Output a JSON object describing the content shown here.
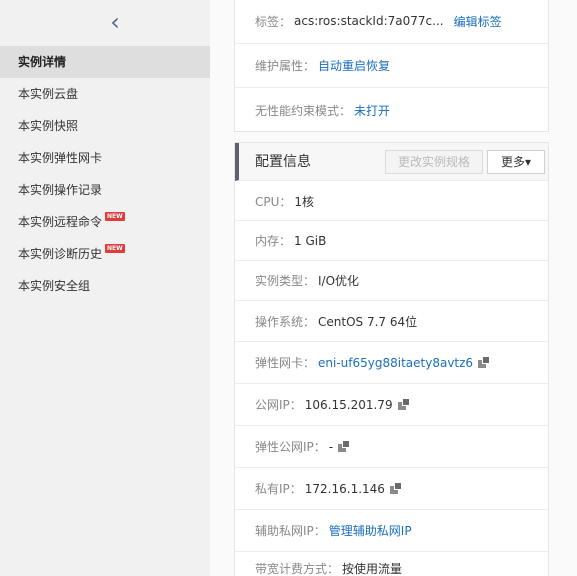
{
  "sidebar": {
    "back_glyph": "‹",
    "items": [
      {
        "label": "实例详情"
      },
      {
        "label": "本实例云盘"
      },
      {
        "label": "本实例快照"
      },
      {
        "label": "本实例弹性网卡"
      },
      {
        "label": "本实例操作记录"
      },
      {
        "label": "本实例远程命令",
        "badge": "NEW"
      },
      {
        "label": "本实例诊断历史",
        "badge": "NEW"
      },
      {
        "label": "本实例安全组"
      }
    ]
  },
  "info": {
    "tags_label": "标签：",
    "tags_value": "acs:ros:stackId:7a077c...",
    "tags_edit": "编辑标签",
    "maint_label": "维护属性：",
    "maint_value": "自动重启恢复",
    "perf_label": "无性能约束模式：",
    "perf_value": "未打开"
  },
  "config": {
    "title": "配置信息",
    "change_spec_button": "更改实例规格",
    "more_button": "更多▾",
    "rows": [
      {
        "label": "CPU：",
        "value": "1核"
      },
      {
        "label": "内存：",
        "value": "1 GiB"
      },
      {
        "label": "实例类型：",
        "value": "I/O优化"
      },
      {
        "label": "操作系统：",
        "value": "CentOS 7.7 64位"
      },
      {
        "label": "弹性网卡：",
        "value": "eni-uf65yg88itaety8avtz6"
      },
      {
        "label": "公网IP：",
        "value": "106.15.201.79"
      },
      {
        "label": "弹性公网IP：",
        "value": "-"
      },
      {
        "label": "私有IP：",
        "value": "172.16.1.146"
      },
      {
        "label": "辅助私网IP：",
        "value": "管理辅助私网IP"
      },
      {
        "label": "带宽计费方式：",
        "value": "按使用流量"
      }
    ]
  },
  "icons": {
    "copy": "copy-icon",
    "back": "chevron-left-icon"
  }
}
